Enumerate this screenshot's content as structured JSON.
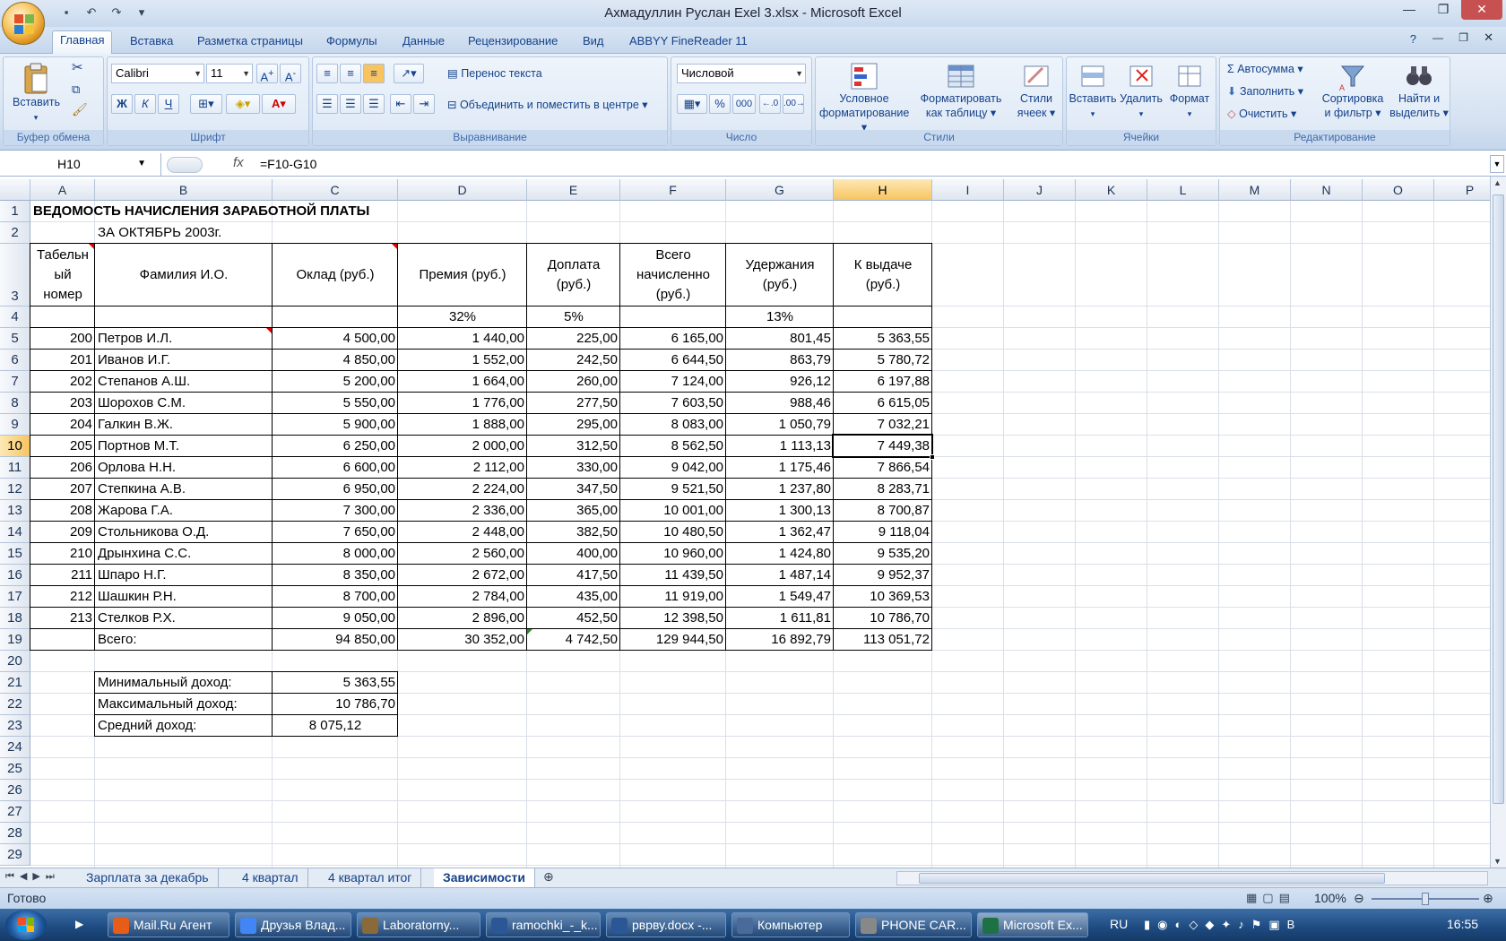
{
  "window": {
    "title": "Ахмадуллин Руслан Exel 3.xlsx - Microsoft Excel"
  },
  "ribbon_tabs": [
    "Главная",
    "Вставка",
    "Разметка страницы",
    "Формулы",
    "Данные",
    "Рецензирование",
    "Вид",
    "ABBYY FineReader 11"
  ],
  "ribbon": {
    "clipboard": {
      "paste": "Вставить",
      "label": "Буфер обмена"
    },
    "font": {
      "name": "Calibri",
      "size": "11",
      "bold": "Ж",
      "italic": "К",
      "underline": "Ч",
      "label": "Шрифт"
    },
    "alignment": {
      "wrap": "Перенос текста",
      "merge": "Объединить и поместить в центре",
      "label": "Выравнивание"
    },
    "number": {
      "format": "Числовой",
      "percent": "%",
      "thousands": "000",
      "label": "Число"
    },
    "styles": {
      "conditional_1": "Условное",
      "conditional_2": "форматирование",
      "table_1": "Форматировать",
      "table_2": "как таблицу",
      "cell_1": "Стили",
      "cell_2": "ячеек",
      "label": "Стили"
    },
    "cells": {
      "insert": "Вставить",
      "delete": "Удалить",
      "format": "Формат",
      "label": "Ячейки"
    },
    "editing": {
      "autosum": "Автосумма",
      "fill": "Заполнить",
      "clear": "Очистить",
      "sort_1": "Сортировка",
      "sort_2": "и фильтр",
      "find_1": "Найти и",
      "find_2": "выделить",
      "label": "Редактирование"
    }
  },
  "formula_bar": {
    "name_box": "H10",
    "fx": "fx",
    "formula": "=F10-G10"
  },
  "columns": [
    "A",
    "B",
    "C",
    "D",
    "E",
    "F",
    "G",
    "H",
    "I",
    "J",
    "K",
    "L",
    "M",
    "N",
    "O",
    "P"
  ],
  "rows": [
    "1",
    "2",
    "3",
    "4",
    "5",
    "6",
    "7",
    "8",
    "9",
    "10",
    "11",
    "12",
    "13",
    "14",
    "15",
    "16",
    "17",
    "18",
    "19",
    "20",
    "21",
    "22",
    "23",
    "24",
    "25",
    "26",
    "27",
    "28",
    "29"
  ],
  "sheet": {
    "title": "ВЕДОМОСТЬ НАЧИСЛЕНИЯ ЗАРАБОТНОЙ ПЛАТЫ",
    "subtitle": "ЗА ОКТЯБРЬ 2003г.",
    "headers": {
      "a": [
        "Табельн",
        "ый",
        "номер"
      ],
      "b": "Фамилия И.О.",
      "c": "Оклад (руб.)",
      "d": "Премия (руб.)",
      "e": [
        "Доплата",
        "(руб.)"
      ],
      "f": [
        "Всего",
        "начисленно",
        "(руб.)"
      ],
      "g": [
        "Удержания",
        "(руб.)"
      ],
      "h": [
        "К выдаче",
        "(руб.)"
      ]
    },
    "rates": {
      "d": "32%",
      "e": "5%",
      "g": "13%"
    },
    "data": [
      [
        "200",
        "Петров И.Л.",
        "4 500,00",
        "1 440,00",
        "225,00",
        "6 165,00",
        "801,45",
        "5 363,55"
      ],
      [
        "201",
        "Иванов И.Г.",
        "4 850,00",
        "1 552,00",
        "242,50",
        "6 644,50",
        "863,79",
        "5 780,72"
      ],
      [
        "202",
        "Степанов А.Ш.",
        "5 200,00",
        "1 664,00",
        "260,00",
        "7 124,00",
        "926,12",
        "6 197,88"
      ],
      [
        "203",
        "Шорохов С.М.",
        "5 550,00",
        "1 776,00",
        "277,50",
        "7 603,50",
        "988,46",
        "6 615,05"
      ],
      [
        "204",
        "Галкин В.Ж.",
        "5 900,00",
        "1 888,00",
        "295,00",
        "8 083,00",
        "1 050,79",
        "7 032,21"
      ],
      [
        "205",
        "Портнов М.Т.",
        "6 250,00",
        "2 000,00",
        "312,50",
        "8 562,50",
        "1 113,13",
        "7 449,38"
      ],
      [
        "206",
        "Орлова Н.Н.",
        "6 600,00",
        "2 112,00",
        "330,00",
        "9 042,00",
        "1 175,46",
        "7 866,54"
      ],
      [
        "207",
        "Степкина А.В.",
        "6 950,00",
        "2 224,00",
        "347,50",
        "9 521,50",
        "1 237,80",
        "8 283,71"
      ],
      [
        "208",
        "Жарова Г.А.",
        "7 300,00",
        "2 336,00",
        "365,00",
        "10 001,00",
        "1 300,13",
        "8 700,87"
      ],
      [
        "209",
        "Стольникова О.Д.",
        "7 650,00",
        "2 448,00",
        "382,50",
        "10 480,50",
        "1 362,47",
        "9 118,04"
      ],
      [
        "210",
        "Дрынхина С.С.",
        "8 000,00",
        "2 560,00",
        "400,00",
        "10 960,00",
        "1 424,80",
        "9 535,20"
      ],
      [
        "211",
        "Шпаро Н.Г.",
        "8 350,00",
        "2 672,00",
        "417,50",
        "11 439,50",
        "1 487,14",
        "9 952,37"
      ],
      [
        "212",
        "Шашкин Р.Н.",
        "8 700,00",
        "2 784,00",
        "435,00",
        "11 919,00",
        "1 549,47",
        "10 369,53"
      ],
      [
        "213",
        "Стелков Р.Х.",
        "9 050,00",
        "2 896,00",
        "452,50",
        "12 398,50",
        "1 611,81",
        "10 786,70"
      ]
    ],
    "total": [
      "Всего:",
      "94 850,00",
      "30 352,00",
      "4 742,50",
      "129 944,50",
      "16 892,79",
      "113 051,72"
    ],
    "stats": [
      [
        "Минимальный доход:",
        "5 363,55"
      ],
      [
        "Максимальный доход:",
        "10 786,70"
      ],
      [
        "Средний доход:",
        "8 075,12"
      ]
    ]
  },
  "sheet_tabs": [
    "Зарплата за декабрь",
    "4 квартал",
    "4 квартал итог",
    "Зависимости"
  ],
  "status": {
    "ready": "Готово",
    "zoom": "100%"
  },
  "taskbar": {
    "items": [
      "Mail.Ru Агент",
      "Друзья Влад...",
      "Laboratorny...",
      "ramochki_-_k...",
      "рвpву.docx -...",
      "Компьютер",
      "PHONE CAR...",
      "Microsoft Ex..."
    ],
    "lang": "RU",
    "time": "16:55"
  },
  "colors": {
    "accent": "#15428b",
    "selection": "#f7c460",
    "ribbon": "#d5e2f1"
  }
}
